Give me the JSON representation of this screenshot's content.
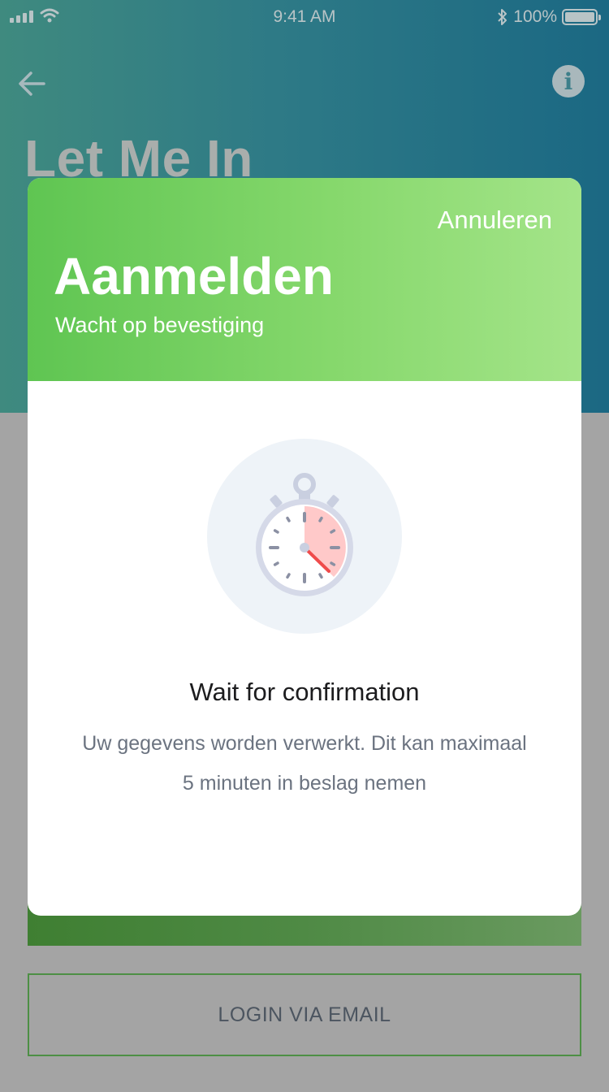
{
  "status_bar": {
    "time": "9:41 AM",
    "battery": "100%",
    "signal_icon": "signal-icon",
    "wifi_icon": "wifi-icon",
    "bluetooth_icon": "bluetooth-icon"
  },
  "background": {
    "title": "Let Me In",
    "info_label": "i",
    "email_button_label": "LOGIN VIA EMAIL"
  },
  "modal": {
    "cancel_label": "Annuleren",
    "title": "Aanmelden",
    "subtitle": "Wacht op bevestiging",
    "icon": "stopwatch-icon",
    "body_title": "Wait for confirmation",
    "body_text": "Uw gegevens worden verwerkt. Dit kan maximaal 5 minuten in beslag nemen"
  },
  "colors": {
    "header_gradient_start": "#5fc552",
    "header_gradient_end": "#a4e489",
    "background_header": "#2e7a86",
    "accent_red": "#ef4b4b"
  }
}
